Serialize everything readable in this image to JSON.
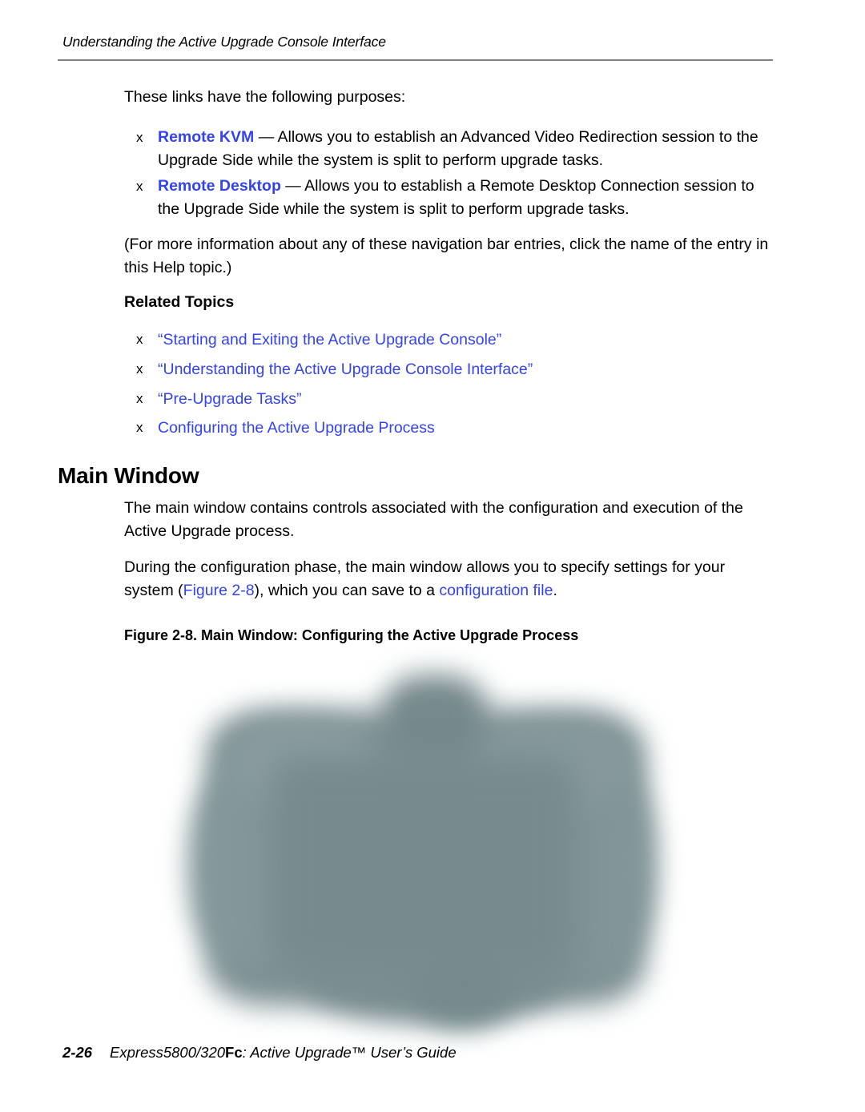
{
  "page": {
    "running_head": "Understanding the Active Upgrade Console Interface",
    "bullet_glyph": "x"
  },
  "intro": {
    "lead": "These links have the following purposes:",
    "links": [
      {
        "label": "Remote KVM",
        "dash": " — ",
        "description": "Allows you to establish an Advanced Video Redirection session to the Upgrade Side while the system is split to perform upgrade tasks."
      },
      {
        "label": "Remote Desktop",
        "dash": " — ",
        "description": "Allows you to establish a Remote Desktop Connection session to the Upgrade Side while the system is split to perform upgrade tasks."
      }
    ],
    "note": "(For more information about any of these navigation bar entries, click the name of the entry in this Help topic.)"
  },
  "related_topics": {
    "heading": "Related Topics",
    "items": [
      {
        "label": "“Starting and Exiting the Active Upgrade Console”"
      },
      {
        "label": "“Understanding the Active Upgrade Console Interface”"
      },
      {
        "label": "“Pre-Upgrade Tasks”"
      },
      {
        "label": "Configuring the Active Upgrade Process"
      }
    ]
  },
  "main_window": {
    "heading": "Main Window",
    "paragraph_1": "The main window contains controls associated with the configuration and execution of the Active Upgrade process.",
    "paragraph_2": {
      "part_1": "During the configuration phase, the main window allows you to specify settings for your system (",
      "figure_link": "Figure 2-8",
      "part_2": "), which you can save to a ",
      "config_link": "configuration file",
      "part_3": "."
    },
    "figure_caption": "Figure 2-8. Main Window: Configuring the Active Upgrade Process"
  },
  "footer": {
    "page_number": "2-26",
    "title_part_1": "Express5800/320",
    "title_fc": "Fc",
    "title_part_2": ": Active Upgrade™ User’s Guide"
  },
  "colors": {
    "link_blue": "#3344ee",
    "rule_gray": "#808080",
    "figure_blob": "#7f9295"
  }
}
